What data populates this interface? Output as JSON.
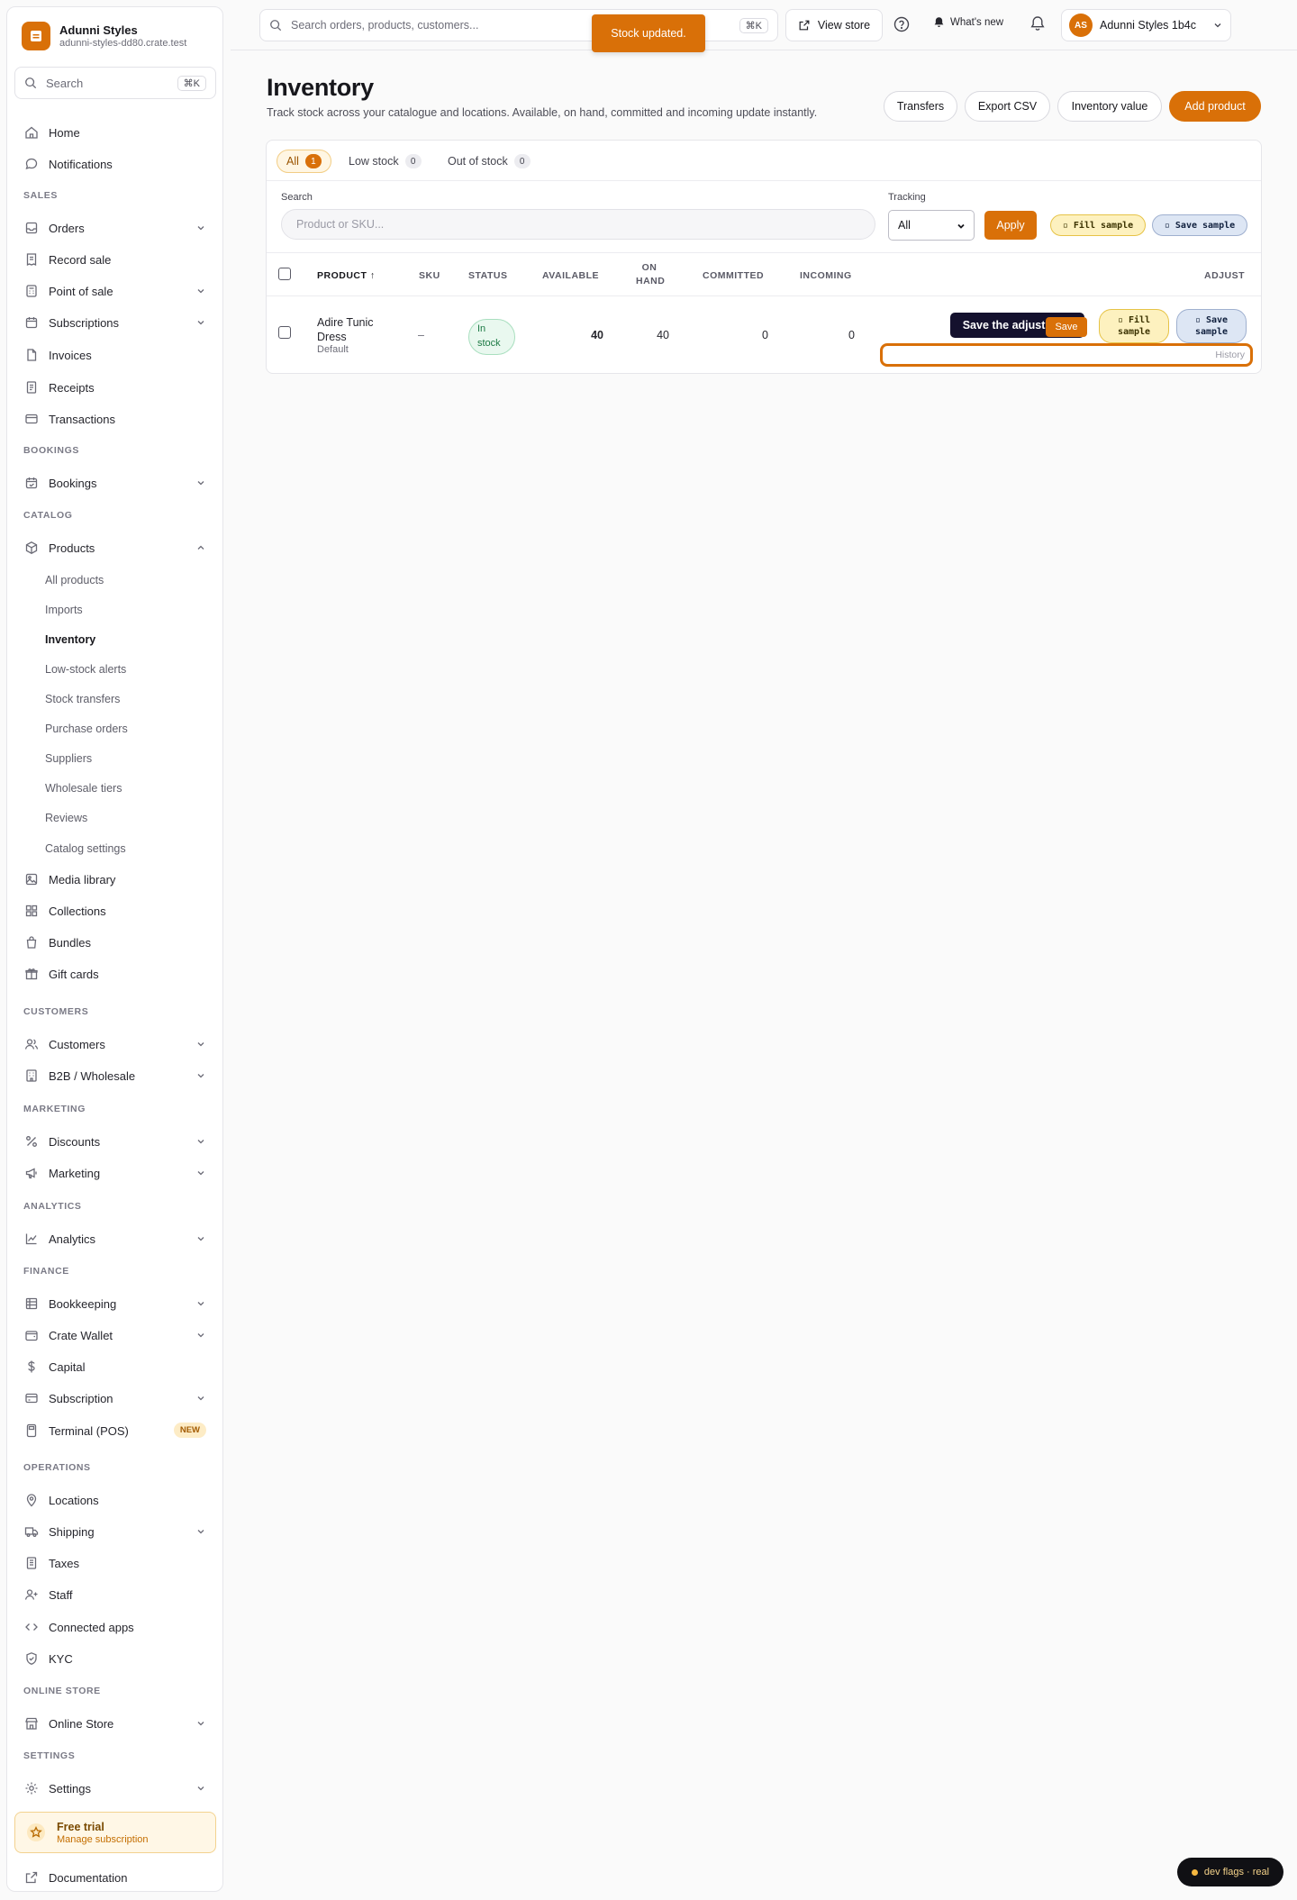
{
  "brand": {
    "name": "Adunni Styles",
    "url": "adunni-styles-dd80.crate.test"
  },
  "sidebar": {
    "search_placeholder": "Search",
    "search_kbd": "⌘K",
    "home": "Home",
    "notifications": "Notifications",
    "sections": {
      "sales": "SALES",
      "bookings": "BOOKINGS",
      "catalog": "CATALOG",
      "customers": "CUSTOMERS",
      "marketing": "MARKETING",
      "analytics": "ANALYTICS",
      "finance": "FINANCE",
      "operations": "OPERATIONS",
      "online_store": "ONLINE STORE",
      "settings": "SETTINGS"
    },
    "orders": "Orders",
    "record_sale": "Record sale",
    "point_of_sale": "Point of sale",
    "subscriptions": "Subscriptions",
    "invoices": "Invoices",
    "receipts": "Receipts",
    "transactions": "Transactions",
    "bookings": "Bookings",
    "products": "Products",
    "product_sub": [
      "All products",
      "Imports",
      "Inventory",
      "Low-stock alerts",
      "Stock transfers",
      "Purchase orders",
      "Suppliers",
      "Wholesale tiers",
      "Reviews",
      "Catalog settings"
    ],
    "media_library": "Media library",
    "collections": "Collections",
    "bundles": "Bundles",
    "gift_cards": "Gift cards",
    "customers": "Customers",
    "b2b": "B2B / Wholesale",
    "discounts": "Discounts",
    "marketing": "Marketing",
    "analytics": "Analytics",
    "bookkeeping": "Bookkeeping",
    "crate_wallet": "Crate Wallet",
    "capital": "Capital",
    "subscription": "Subscription",
    "terminal": "Terminal (POS)",
    "terminal_badge": "NEW",
    "locations": "Locations",
    "shipping": "Shipping",
    "taxes": "Taxes",
    "staff": "Staff",
    "connected_apps": "Connected apps",
    "kyc": "KYC",
    "online_store": "Online Store",
    "settings": "Settings",
    "trial_title": "Free trial",
    "trial_sub": "Manage subscription",
    "documentation": "Documentation"
  },
  "topbar": {
    "search_placeholder": "Search orders, products, customers...",
    "search_kbd": "⌘K",
    "view_store": "View store",
    "whats_new": "What's new",
    "avatar_initials": "AS",
    "account_name": "Adunni Styles 1b4c"
  },
  "toast": "Stock updated.",
  "page": {
    "title": "Inventory",
    "subtitle": "Track stock across your catalogue and locations. Available, on hand, committed and incoming update instantly.",
    "buttons": {
      "transfers": "Transfers",
      "export": "Export CSV",
      "inventory_value": "Inventory value",
      "add_product": "Add product"
    }
  },
  "tabs": [
    {
      "label": "All",
      "count": "1"
    },
    {
      "label": "Low stock",
      "count": "0"
    },
    {
      "label": "Out of stock",
      "count": "0"
    }
  ],
  "filters": {
    "search_label": "Search",
    "search_placeholder": "Product or SKU...",
    "tracking_label": "Tracking",
    "tracking_value": "All",
    "apply": "Apply",
    "fill_sample": "▫ Fill sample",
    "save_sample": "▫ Save sample"
  },
  "table": {
    "headers": {
      "product": "PRODUCT ↑",
      "sku": "SKU",
      "status": "STATUS",
      "available": "AVAILABLE",
      "on_hand_1": "ON",
      "on_hand_2": "HAND",
      "committed": "COMMITTED",
      "incoming": "INCOMING",
      "adjust": "ADJUST"
    },
    "row": {
      "name_1": "Adire Tunic",
      "name_2": "Dress",
      "variant": "Default",
      "sku": "–",
      "status_1": "In",
      "status_2": "stock",
      "available": "40",
      "on_hand": "40",
      "committed": "0",
      "incoming": "0",
      "save": "Save",
      "tooltip": "Save the adjustment",
      "fill_sample_1": "▫ Fill",
      "fill_sample_2": "sample",
      "save_sample_1": "▫ Save",
      "save_sample_2": "sample",
      "history_placeholder": "History"
    }
  },
  "dev_flags": "dev flags · real",
  "colors": {
    "accent": "#d97008",
    "tooltip": "#14112e"
  }
}
